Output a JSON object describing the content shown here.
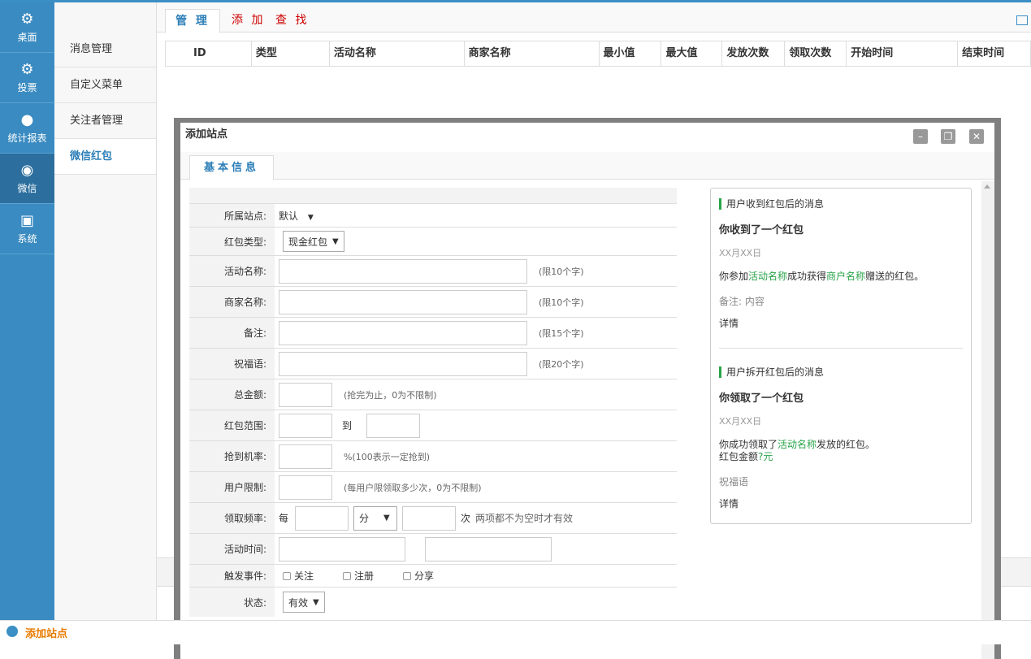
{
  "nav": {
    "items": [
      {
        "label": "桌面",
        "icon": "gear-icon"
      },
      {
        "label": "投票",
        "icon": "gear-icon"
      },
      {
        "label": "统计报表",
        "icon": "user-icon"
      },
      {
        "label": "微信",
        "icon": "wechat-icon"
      },
      {
        "label": "系统",
        "icon": "box-icon"
      }
    ]
  },
  "submenu": {
    "items": [
      {
        "label": "消息管理"
      },
      {
        "label": "自定义菜单"
      },
      {
        "label": "关注者管理"
      },
      {
        "label": "微信红包"
      }
    ]
  },
  "tabs": {
    "manage": "管 理",
    "add": "添 加",
    "search": "查 找"
  },
  "table": {
    "headers": [
      "ID",
      "类型",
      "活动名称",
      "商家名称",
      "最小值",
      "最大值",
      "发放次数",
      "领取次数",
      "开始时间",
      "结束时间"
    ]
  },
  "dialog": {
    "title": "添加站点",
    "tab": "基本信息",
    "form": {
      "site_label": "所属站点:",
      "site_value": "默认",
      "type_label": "红包类型:",
      "type_value": "现金红包",
      "name_label": "活动名称:",
      "name_hint": "(限10个字)",
      "merchant_label": "商家名称:",
      "merchant_hint": "(限10个字)",
      "note_label": "备注:",
      "note_hint": "(限15个字)",
      "wish_label": "祝福语:",
      "wish_hint": "(限20个字)",
      "total_label": "总金额:",
      "total_hint": "(抢完为止，0为不限制)",
      "range_label": "红包范围:",
      "range_to": "到",
      "prob_label": "抢到机率:",
      "prob_hint": "%(100表示一定抢到)",
      "limit_label": "用户限制:",
      "limit_hint": "(每用户限领取多少次，0为不限制)",
      "freq_label": "领取频率:",
      "freq_each": "每",
      "freq_unit": "分",
      "freq_times": "次",
      "freq_hint": "两项都不为空时才有效",
      "time_label": "活动时间:",
      "trigger_label": "触发事件:",
      "trigger_follow": "关注",
      "trigger_register": "注册",
      "trigger_share": "分享",
      "status_label": "状态:",
      "status_value": "有效"
    },
    "preview": {
      "recv_header": "用户收到红包后的消息",
      "recv_title": "你收到了一个红包",
      "recv_date": "XX月XX日",
      "recv_p1": "你参加",
      "recv_act": "活动名称",
      "recv_p2": "成功获得",
      "recv_merchant": "商户名称",
      "recv_p3": "赠送的红包。",
      "recv_note": "备注: 内容",
      "recv_detail": "详情",
      "open_header": "用户拆开红包后的消息",
      "open_title": "你领取了一个红包",
      "open_date": "XX月XX日",
      "open_p1": "你成功领取了",
      "open_act": "活动名称",
      "open_p2": "发放的红包。",
      "open_amount_label": "红包金额",
      "open_amount": "?元",
      "open_wish": "祝福语",
      "open_detail": "详情"
    }
  },
  "taskbar": {
    "label": "添加站点"
  },
  "colors": {
    "nav": "#3a8bc1",
    "accent": "#2d7fb8",
    "green": "#2aa34a",
    "red": "#cc0000"
  }
}
